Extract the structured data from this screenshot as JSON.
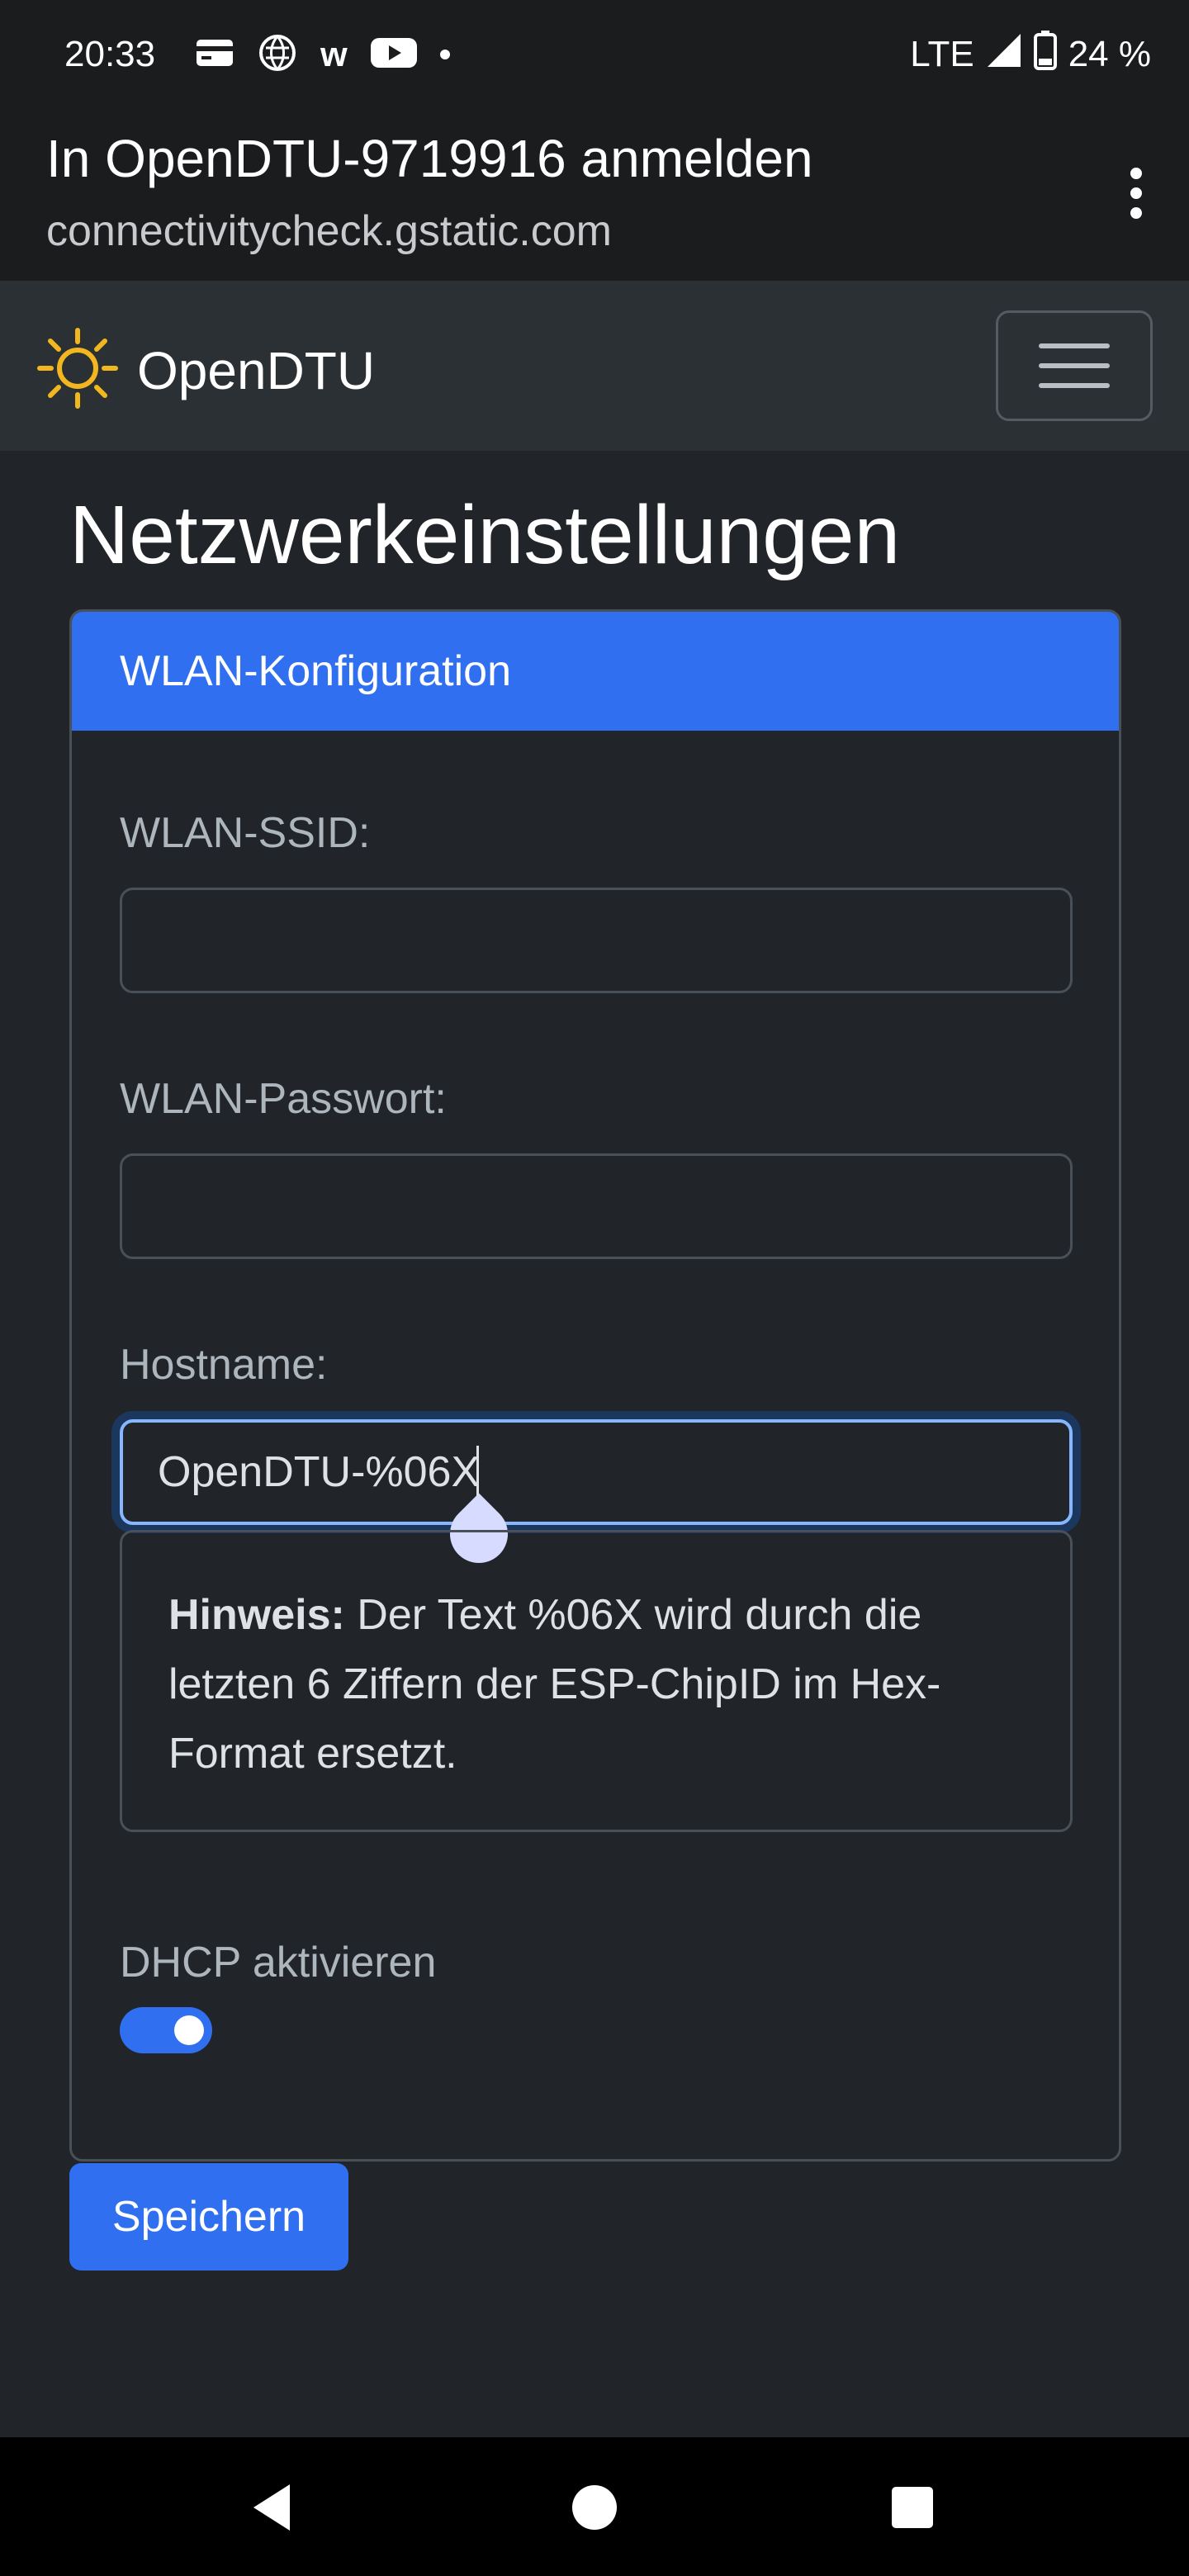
{
  "status_bar": {
    "time": "20:33",
    "network": "LTE",
    "battery": "24 %",
    "icons": [
      "card-icon",
      "vpn-globe-icon",
      "w-icon",
      "youtube-icon",
      "dot-icon",
      "signal-icon",
      "battery-icon"
    ]
  },
  "portal": {
    "title": "In OpenDTU-9719916 anmelden",
    "url": "connectivitycheck.gstatic.com"
  },
  "navbar": {
    "brand": "OpenDTU"
  },
  "page": {
    "title": "Netzwerkeinstellungen"
  },
  "card": {
    "header": "WLAN-Konfiguration",
    "ssid_label": "WLAN-SSID:",
    "ssid_value": "",
    "password_label": "WLAN-Passwort:",
    "password_value": "",
    "hostname_label": "Hostname:",
    "hostname_value": "OpenDTU-%06X",
    "hint_title": "Hinweis:",
    "hint_text": " Der Text %06X wird durch die letzten 6 Ziffern der ESP-ChipID im Hex-Format ersetzt.",
    "dhcp_label": "DHCP aktivieren",
    "dhcp_enabled": true
  },
  "actions": {
    "save_label": "Speichern"
  },
  "colors": {
    "accent": "#3070f0",
    "background": "#212529",
    "navbar": "#2b3035",
    "sun": "#f2b61f"
  }
}
